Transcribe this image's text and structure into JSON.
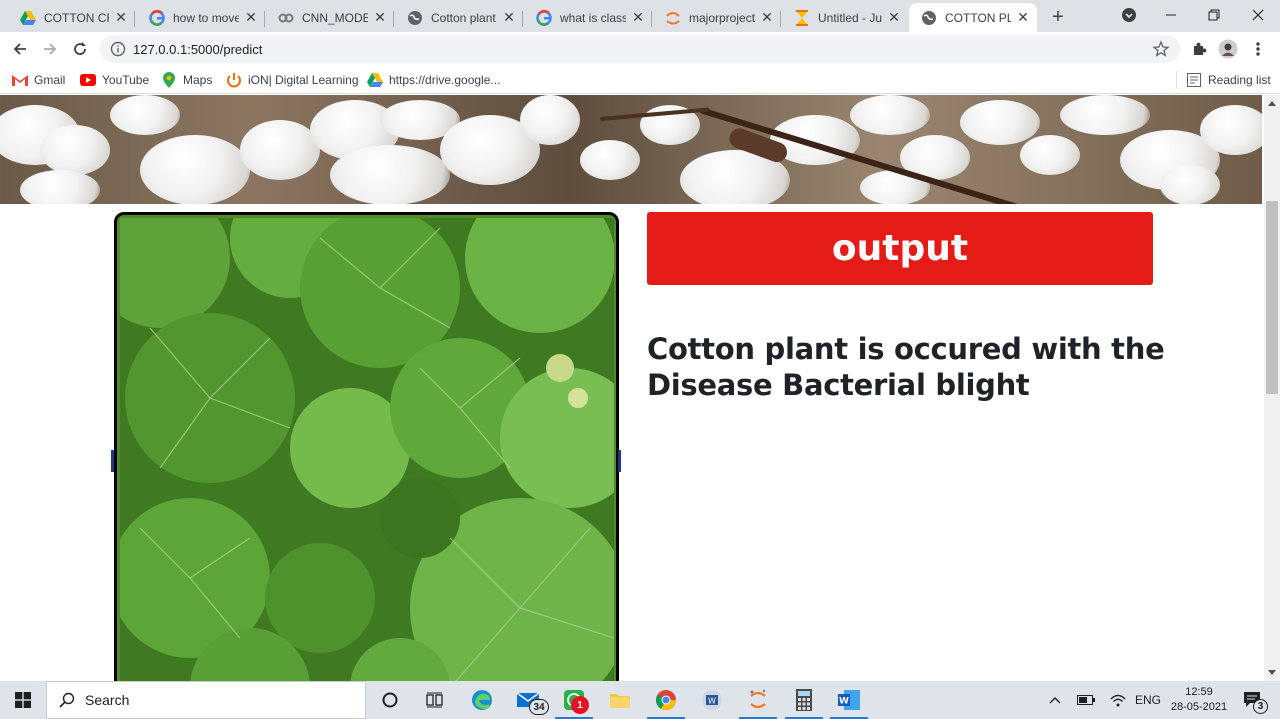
{
  "browser": {
    "tabs": [
      {
        "title": "COTTON CRO",
        "icon": "google-drive-icon",
        "active": false
      },
      {
        "title": "how to move",
        "icon": "google-icon",
        "active": false
      },
      {
        "title": "CNN_MODEL",
        "icon": "colab-icon",
        "active": false
      },
      {
        "title": "Cotton plant",
        "icon": "globe-icon",
        "active": false
      },
      {
        "title": "what is classif",
        "icon": "google-icon",
        "active": false
      },
      {
        "title": "majorproject/",
        "icon": "jupyter-icon",
        "active": false
      },
      {
        "title": "Untitled - Jup",
        "icon": "hourglass-icon",
        "active": false
      },
      {
        "title": "COTTON PLA",
        "icon": "globe-icon",
        "active": true
      }
    ],
    "url": "127.0.0.1:5000/predict",
    "bookmarks": [
      {
        "label": "Gmail",
        "icon": "gmail-icon"
      },
      {
        "label": "YouTube",
        "icon": "youtube-icon"
      },
      {
        "label": "Maps",
        "icon": "maps-icon"
      },
      {
        "label": "iON| Digital Learning",
        "icon": "ion-icon"
      },
      {
        "label": "https://drive.google...",
        "icon": "google-drive-icon"
      }
    ],
    "reading_list": "Reading list"
  },
  "page": {
    "output_button": "output",
    "result_text": "Cotton plant is occured with the Disease Bacterial blight"
  },
  "taskbar": {
    "search_label": "Search",
    "mail_badge": "34",
    "whatsapp_badge": "1",
    "language": "ENG",
    "time": "12:59",
    "date": "28-05-2021",
    "notification_count": "3"
  },
  "colors": {
    "output_red": "#e41b17",
    "tab_bar": "#dee1e6",
    "taskbar": "#dfe4ea"
  }
}
